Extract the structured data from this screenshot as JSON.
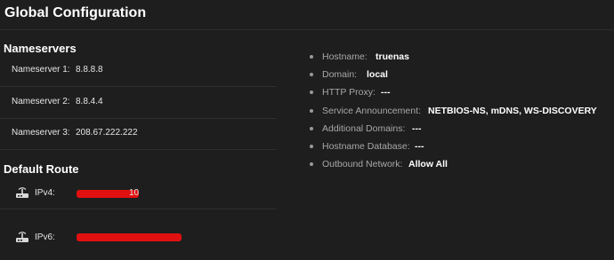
{
  "page": {
    "title": "Global Configuration"
  },
  "nameservers": {
    "heading": "Nameservers",
    "items": [
      {
        "label": "Nameserver 1:",
        "value": "8.8.8.8"
      },
      {
        "label": "Nameserver 2:",
        "value": "8.8.4.4"
      },
      {
        "label": "Nameserver 3:",
        "value": "208.67.222.222"
      }
    ]
  },
  "default_route": {
    "heading": "Default Route",
    "items": [
      {
        "label": "IPv4:",
        "icon": "network-route-icon",
        "value_visible": "10"
      },
      {
        "label": "IPv6:",
        "icon": "network-route-icon",
        "value_visible": ""
      }
    ],
    "redaction_color": "#e01010"
  },
  "details": {
    "items": [
      {
        "label": "Hostname:",
        "value": "truenas"
      },
      {
        "label": "Domain:",
        "value": "local"
      },
      {
        "label": "HTTP Proxy:",
        "value": "---"
      },
      {
        "label": "Service Announcement:",
        "value": "NETBIOS-NS, mDNS, WS-DISCOVERY"
      },
      {
        "label": "Additional Domains:",
        "value": "---"
      },
      {
        "label": "Hostname Database:",
        "value": "---"
      },
      {
        "label": "Outbound Network:",
        "value": "Allow All"
      }
    ]
  },
  "colors": {
    "background": "#1e1e1e",
    "text": "#e0e0e0",
    "muted_label": "#a8a8a8"
  }
}
